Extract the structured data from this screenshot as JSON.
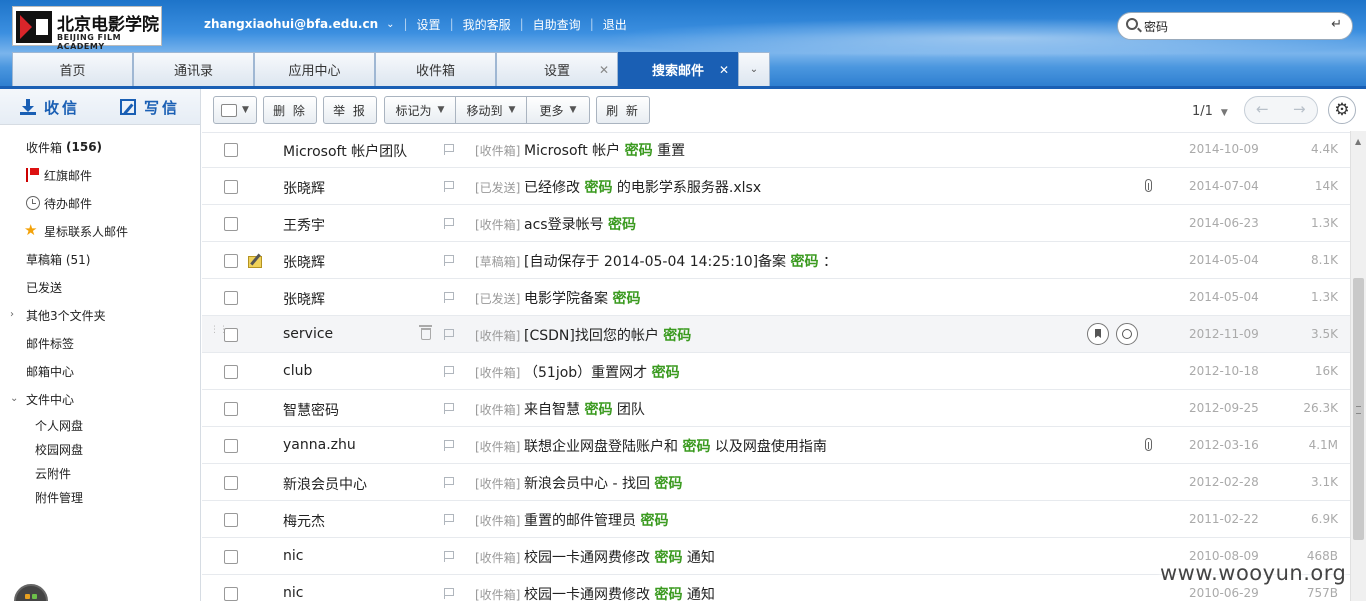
{
  "logo": {
    "cn": "北京电影学院",
    "en": "BEIJING FILM ACADEMY"
  },
  "topbar": {
    "user": "zhangxiaohui@bfa.edu.cn",
    "links": [
      "设置",
      "我的客服",
      "自助查询",
      "退出"
    ]
  },
  "search": {
    "value": "密码"
  },
  "tabs": [
    {
      "label": "首页",
      "closable": false,
      "active": false
    },
    {
      "label": "通讯录",
      "closable": false,
      "active": false
    },
    {
      "label": "应用中心",
      "closable": false,
      "active": false
    },
    {
      "label": "收件箱",
      "closable": false,
      "active": false
    },
    {
      "label": "设置",
      "closable": true,
      "active": false
    },
    {
      "label": "搜索邮件",
      "closable": true,
      "active": true
    }
  ],
  "compose": {
    "receive": "收信",
    "write": "写信"
  },
  "sidebar": {
    "inbox": {
      "label": "收件箱",
      "count": "(156)"
    },
    "flagged": "红旗邮件",
    "todo": "待办邮件",
    "starred": "星标联系人邮件",
    "drafts": "草稿箱 (51)",
    "sent": "已发送",
    "other": "其他3个文件夹",
    "tags": "邮件标签",
    "center": "邮箱中心",
    "files": "文件中心",
    "files_sub": [
      "个人网盘",
      "校园网盘",
      "云附件",
      "附件管理"
    ]
  },
  "toolbar": {
    "delete": "删 除",
    "report": "举 报",
    "mark": "标记为",
    "move": "移动到",
    "more": "更多",
    "refresh": "刷 新",
    "page": "1/1"
  },
  "keyword": "密码",
  "mails": [
    {
      "sender": "Microsoft 帐户团队",
      "folder": "[收件箱]",
      "pre": "Microsoft 帐户 ",
      "post": " 重置",
      "attach": false,
      "date": "2014-10-09",
      "size": "4.4K"
    },
    {
      "sender": "张晓辉",
      "folder": "[已发送]",
      "pre": "已经修改 ",
      "post": " 的电影学系服务器.xlsx",
      "attach": true,
      "date": "2014-07-04",
      "size": "14K"
    },
    {
      "sender": "王秀宇",
      "folder": "[收件箱]",
      "pre": "acs登录帐号 ",
      "post": "",
      "attach": false,
      "date": "2014-06-23",
      "size": "1.3K"
    },
    {
      "sender": "张晓辉",
      "folder": "[草稿箱]",
      "pre": "[自动保存于 2014-05-04 14:25:10]备案 ",
      "post": " ：",
      "attach": false,
      "draft": true,
      "date": "2014-05-04",
      "size": "8.1K"
    },
    {
      "sender": "张晓辉",
      "folder": "[已发送]",
      "pre": "电影学院备案 ",
      "post": "",
      "attach": false,
      "date": "2014-05-04",
      "size": "1.3K"
    },
    {
      "sender": "service",
      "folder": "[收件箱]",
      "pre": "[CSDN]找回您的帐户 ",
      "post": "",
      "attach": false,
      "hover": true,
      "date": "2012-11-09",
      "size": "3.5K"
    },
    {
      "sender": "club",
      "folder": "[收件箱]",
      "pre": "（51job）重置网才 ",
      "post": "",
      "attach": false,
      "date": "2012-10-18",
      "size": "16K"
    },
    {
      "sender": "智慧密码",
      "folder": "[收件箱]",
      "pre": "来自智慧 ",
      "post": " 团队",
      "attach": false,
      "date": "2012-09-25",
      "size": "26.3K"
    },
    {
      "sender": "yanna.zhu",
      "folder": "[收件箱]",
      "pre": "联想企业网盘登陆账户和 ",
      "post": " 以及网盘使用指南",
      "attach": true,
      "date": "2012-03-16",
      "size": "4.1M"
    },
    {
      "sender": "新浪会员中心",
      "folder": "[收件箱]",
      "pre": "新浪会员中心  -  找回 ",
      "post": "",
      "attach": false,
      "date": "2012-02-28",
      "size": "3.1K"
    },
    {
      "sender": "梅元杰",
      "folder": "[收件箱]",
      "pre": "重置的邮件管理员 ",
      "post": "",
      "attach": false,
      "date": "2011-02-22",
      "size": "6.9K"
    },
    {
      "sender": "nic",
      "folder": "[收件箱]",
      "pre": "校园一卡通网费修改 ",
      "post": " 通知",
      "attach": false,
      "date": "2010-08-09",
      "size": "468B"
    },
    {
      "sender": "nic",
      "folder": "[收件箱]",
      "pre": "校园一卡通网费修改 ",
      "post": " 通知",
      "attach": false,
      "date": "2010-06-29",
      "size": "757B"
    }
  ],
  "watermark": "www.wooyun.org"
}
